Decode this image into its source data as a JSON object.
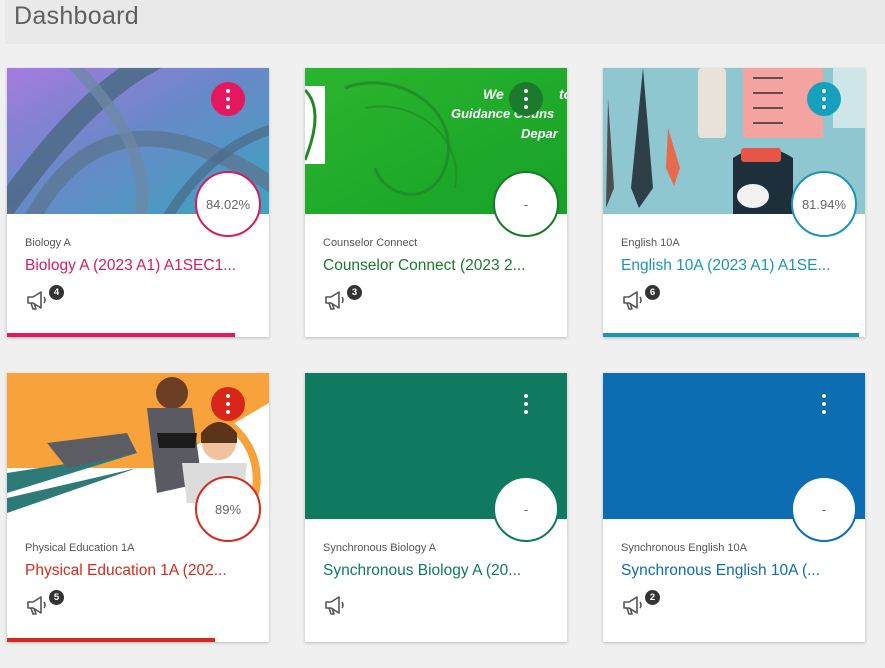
{
  "header": {
    "title": "Dashboard"
  },
  "cards": [
    {
      "subtitle": "Biology A",
      "title": "Biology A (2023 A1) A1SEC1...",
      "grade": "84.02%",
      "announcements": "4",
      "color": "#d81b60",
      "hero": "biology",
      "progress": 0.87
    },
    {
      "subtitle": "Counselor Connect",
      "title": "Counselor Connect (2023 2...",
      "grade": "-",
      "announcements": "3",
      "color": "#1a7a2a",
      "hero": "counselor",
      "progress": 0,
      "hero_text": [
        "We",
        "to",
        "Guidance Couns",
        "Depar"
      ]
    },
    {
      "subtitle": "English 10A",
      "title": "English 10A (2023 A1) A1SE...",
      "grade": "81.94%",
      "announcements": "6",
      "color": "#1a96b4",
      "hero": "english",
      "progress": 0.98
    },
    {
      "subtitle": "Physical Education 1A",
      "title": "Physical Education 1A (202...",
      "grade": "89%",
      "announcements": "5",
      "color": "#d62a1c",
      "hero": "pe",
      "progress": 0.8
    },
    {
      "subtitle": "Synchronous Biology A",
      "title": "Synchronous Biology A (20...",
      "grade": "-",
      "announcements": "",
      "color": "#0f7a60",
      "hero": "solid-teal",
      "progress": 0
    },
    {
      "subtitle": "Synchronous English 10A",
      "title": "Synchronous English 10A (...",
      "grade": "-",
      "announcements": "2",
      "color": "#0c6db3",
      "hero": "solid-blue",
      "progress": 0
    }
  ]
}
